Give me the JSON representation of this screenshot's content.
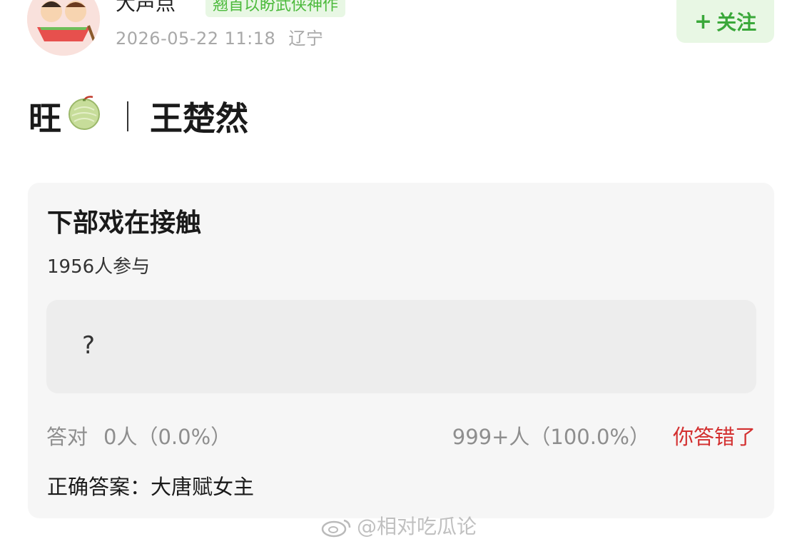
{
  "user": {
    "name": "大声点",
    "tag": "翘首以盼武侠神作",
    "timestamp": "2026-05-22 11:18",
    "location": "辽宁"
  },
  "follow": {
    "label": "关注",
    "plus": "+"
  },
  "post": {
    "title_left": "旺",
    "emoji": "melon-icon",
    "title_right": "王楚然"
  },
  "quiz": {
    "question": "下部戏在接触",
    "participants": "1956人参与",
    "option_text": "?",
    "correct_label": "答对",
    "correct_stat": "0人（0.0%）",
    "wrong_stat": "999+人（100.0%）",
    "result": "你答错了",
    "answer_label": "正确答案：",
    "answer_value": "大唐赋女主"
  },
  "watermark": "@相对吃瓜论",
  "colors": {
    "accent_green": "#3aa83a",
    "tag_bg": "#e8f7e4",
    "wrong_red": "#d32f2f",
    "card_bg": "#f6f6f6"
  }
}
